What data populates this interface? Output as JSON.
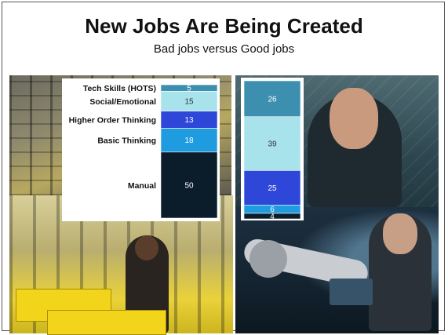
{
  "slide": {
    "title": "New Jobs Are Being Created",
    "subtitle": "Bad jobs versus Good jobs"
  },
  "photos": {
    "top_left": "warehouse-shelves-photo",
    "bottom_left": "warehouse-worker-photo",
    "top_right": "thinking-man-photo",
    "bottom_right": "robot-arm-photo"
  },
  "chart_data": [
    {
      "type": "bar",
      "stacked": true,
      "title": "",
      "xlabel": "",
      "ylabel": "",
      "categories": [
        "Tech Skills (HOTS)",
        "Social/Emotional",
        "Higher Order Thinking",
        "Basic Thinking",
        "Manual"
      ],
      "values": [
        5,
        15,
        13,
        18,
        50
      ],
      "colors": [
        "#3d8fb0",
        "#a8e2ea",
        "#2f47d9",
        "#1f9be0",
        "#0b1d2b"
      ],
      "data_label_colors": [
        "#ffffff",
        "#333333",
        "#ffffff",
        "#ffffff",
        "#ffffff"
      ],
      "ylim": [
        0,
        101
      ]
    },
    {
      "type": "bar",
      "stacked": true,
      "title": "",
      "xlabel": "",
      "ylabel": "",
      "categories": [
        "",
        "",
        "",
        "",
        ""
      ],
      "values": [
        26,
        39,
        25,
        6,
        4
      ],
      "colors": [
        "#3d8fb0",
        "#a8e2ea",
        "#2f47d9",
        "#1f9be0",
        "#0b1d2b"
      ],
      "data_label_colors": [
        "#ffffff",
        "#333333",
        "#ffffff",
        "#ffffff",
        "#ffffff"
      ],
      "ylim": [
        0,
        100
      ]
    }
  ]
}
